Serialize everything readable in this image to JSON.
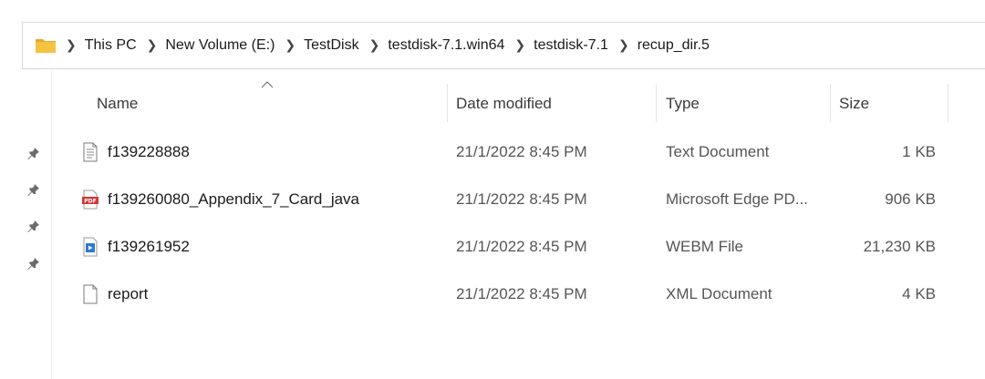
{
  "breadcrumb": {
    "items": [
      "This PC",
      "New Volume (E:)",
      "TestDisk",
      "testdisk-7.1.win64",
      "testdisk-7.1",
      "recup_dir.5"
    ]
  },
  "columns": {
    "name": "Name",
    "date": "Date modified",
    "type": "Type",
    "size": "Size"
  },
  "files": [
    {
      "name": "f139228888",
      "date": "21/1/2022 8:45 PM",
      "type": "Text Document",
      "size": "1 KB",
      "icon": "text-file-icon"
    },
    {
      "name": "f139260080_Appendix_7_Card_java",
      "date": "21/1/2022 8:45 PM",
      "type": "Microsoft Edge PD...",
      "size": "906 KB",
      "icon": "pdf-file-icon"
    },
    {
      "name": "f139261952",
      "date": "21/1/2022 8:45 PM",
      "type": "WEBM File",
      "size": "21,230 KB",
      "icon": "video-file-icon"
    },
    {
      "name": "report",
      "date": "21/1/2022 8:45 PM",
      "type": "XML Document",
      "size": "4 KB",
      "icon": "blank-file-icon"
    }
  ],
  "icons": {
    "pdf_label": "PDF"
  },
  "colors": {
    "folder_yellow": "#f5c342",
    "pdf_red": "#d13438",
    "video_blue": "#2b7bd1"
  }
}
